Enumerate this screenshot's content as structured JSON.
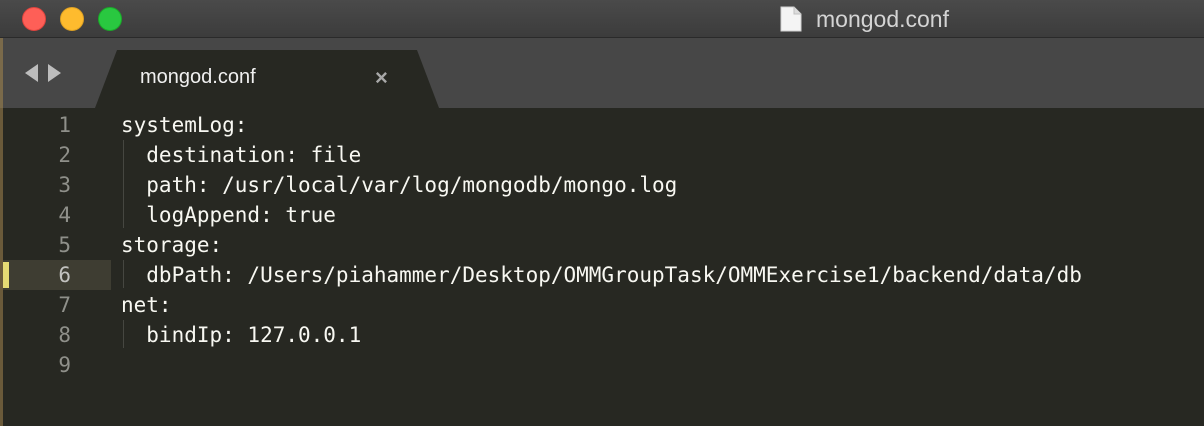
{
  "window": {
    "title": "mongod.conf",
    "colors": {
      "close": "#fe5f57",
      "minimize": "#febb2e",
      "maximize": "#29c840"
    }
  },
  "tabs": [
    {
      "label": "mongod.conf",
      "close_glyph": "×",
      "active": true
    }
  ],
  "editor": {
    "active_line": 6,
    "lines": [
      {
        "num": "1",
        "text": "systemLog:"
      },
      {
        "num": "2",
        "text": "  destination: file"
      },
      {
        "num": "3",
        "text": "  path: /usr/local/var/log/mongodb/mongo.log"
      },
      {
        "num": "4",
        "text": "  logAppend: true"
      },
      {
        "num": "5",
        "text": "storage:"
      },
      {
        "num": "6",
        "text": "  dbPath: /Users/piahammer/Desktop/OMMGroupTask/OMMExercise1/backend/data/db"
      },
      {
        "num": "7",
        "text": "net:"
      },
      {
        "num": "8",
        "text": "  bindIp: 127.0.0.1"
      },
      {
        "num": "9",
        "text": ""
      }
    ]
  }
}
